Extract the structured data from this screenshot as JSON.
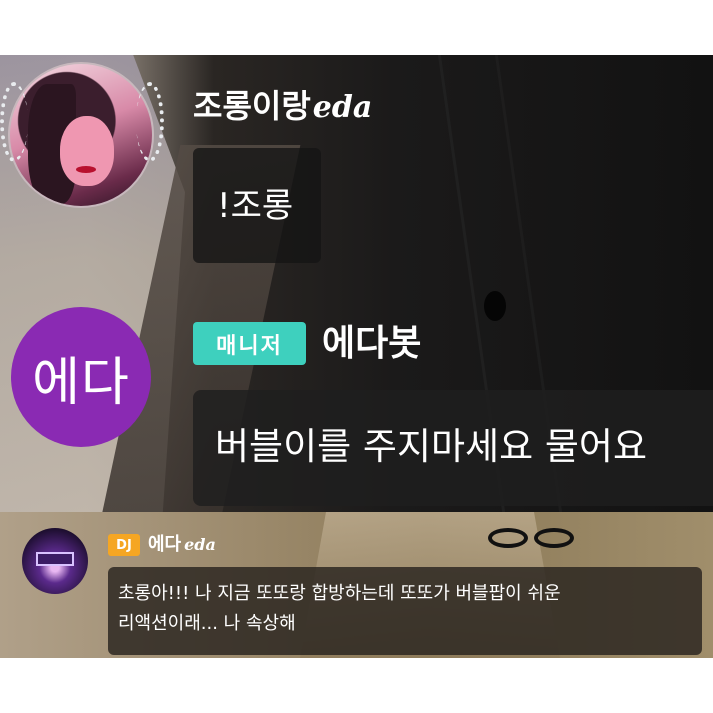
{
  "top_chat": {
    "sender_name": "조롱이랑",
    "sender_name_script": "eda",
    "message_1": "!조롱",
    "manager_badge": "매니저",
    "bot_name": "에다봇",
    "bot_avatar_text": "에다",
    "message_2": "버블이를 주지마세요 물어요"
  },
  "bottom_chat": {
    "dj_badge": "DJ",
    "dj_name": "에다",
    "dj_name_script": "eda",
    "message": "초롱아!!! 나 지금 또또랑 합방하는데 또또가 버블팝이 쉬운\n리액션이래... 나 속상해"
  },
  "colors": {
    "bot_avatar_bg": "#8a2ab3",
    "manager_badge_bg": "#3ed0be",
    "dj_badge_bg": "#f5a623"
  }
}
